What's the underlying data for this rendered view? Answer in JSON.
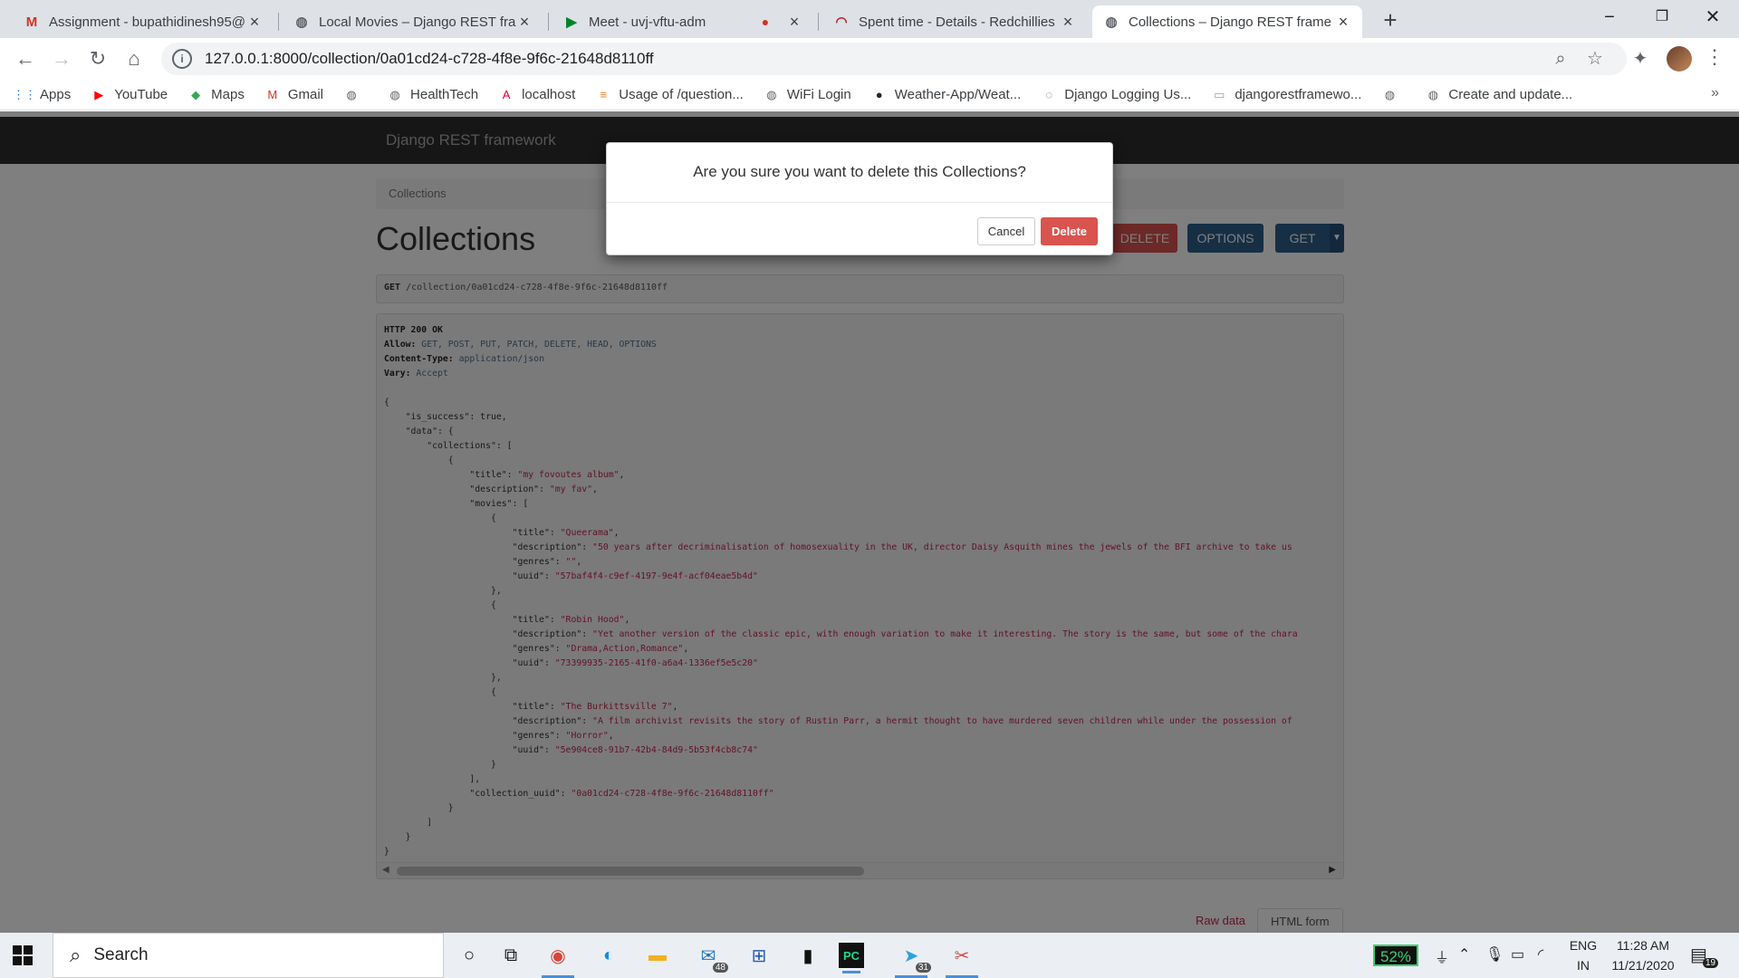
{
  "browser": {
    "tabs": [
      {
        "title": "Assignment - bupathidinesh95@",
        "icon": "gmail-icon",
        "icon_glyph": "M",
        "icon_color": "#d93025",
        "active": false
      },
      {
        "title": "Local Movies – Django REST fram",
        "icon": "globe-icon",
        "icon_glyph": "◍",
        "icon_color": "#5f6368",
        "active": false
      },
      {
        "title": "Meet - uvj-vftu-adm",
        "icon": "meet-icon",
        "icon_glyph": "▶",
        "icon_color": "#00832d",
        "active": false
      },
      {
        "title": "Spent time - Details - Redchillies",
        "icon": "redmine-icon",
        "icon_glyph": "◠",
        "icon_color": "#b32024",
        "active": false
      },
      {
        "title": "Collections – Django REST frame",
        "icon": "globe-icon",
        "icon_glyph": "◍",
        "icon_color": "#5f6368",
        "active": true
      }
    ],
    "url": "127.0.0.1:8000/collection/0a01cd24-c728-4f8e-9f6c-21648d8110ff",
    "bookmarks": [
      {
        "label": "Apps",
        "icon": "apps-grid-icon",
        "glyph": "⋮⋮",
        "color": "#1a73e8"
      },
      {
        "label": "YouTube",
        "icon": "youtube-icon",
        "glyph": "▶",
        "color": "#ff0000"
      },
      {
        "label": "Maps",
        "icon": "maps-icon",
        "glyph": "◆",
        "color": "#34a853"
      },
      {
        "label": "Gmail",
        "icon": "gmail-icon",
        "glyph": "M",
        "color": "#d93025"
      },
      {
        "label": "",
        "icon": "globe-icon",
        "glyph": "◍",
        "color": "#5f6368"
      },
      {
        "label": "HealthTech",
        "icon": "globe-icon",
        "glyph": "◍",
        "color": "#5f6368"
      },
      {
        "label": "localhost",
        "icon": "angular-icon",
        "glyph": "A",
        "color": "#dd0031"
      },
      {
        "label": "Usage of /question...",
        "icon": "stackoverflow-icon",
        "glyph": "≡",
        "color": "#f48024"
      },
      {
        "label": "WiFi Login",
        "icon": "globe-icon",
        "glyph": "◍",
        "color": "#5f6368"
      },
      {
        "label": "Weather-App/Weat...",
        "icon": "github-icon",
        "glyph": "●",
        "color": "#24292e"
      },
      {
        "label": "Django Logging Us...",
        "icon": "lightbulb-icon",
        "glyph": "◌",
        "color": "#5f6368"
      },
      {
        "label": "djangorestframewo...",
        "icon": "page-icon",
        "glyph": "▭",
        "color": "#9aa0a6"
      },
      {
        "label": "",
        "icon": "globe-icon",
        "glyph": "◍",
        "color": "#5f6368"
      },
      {
        "label": "Create and update...",
        "icon": "globe-icon",
        "glyph": "◍",
        "color": "#5f6368"
      }
    ]
  },
  "drf": {
    "brand": "Django REST framework",
    "breadcrumb": "Collections",
    "title": "Collections",
    "buttons": {
      "delete": "DELETE",
      "options": "OPTIONS",
      "get": "GET"
    },
    "request": {
      "method": "GET",
      "path": "/collection/0a01cd24-c728-4f8e-9f6c-21648d8110ff"
    },
    "response_headers": [
      {
        "key": "HTTP 200 OK",
        "value": ""
      },
      {
        "key": "Allow:",
        "value": "GET, POST, PUT, PATCH, DELETE, HEAD, OPTIONS"
      },
      {
        "key": "Content-Type:",
        "value": "application/json"
      },
      {
        "key": "Vary:",
        "value": "Accept"
      }
    ],
    "response_body": {
      "is_success": "true",
      "collection_title": "\"my fovoutes album\"",
      "collection_description": "\"my fav\"",
      "movies": [
        {
          "title": "\"Queerama\"",
          "description": "\"50 years after decriminalisation of homosexuality in the UK, director Daisy Asquith mines the jewels of the BFI archive to take us",
          "genres": "\"\"",
          "uuid": "\"57baf4f4-c9ef-4197-9e4f-acf04eae5b4d\""
        },
        {
          "title": "\"Robin Hood\"",
          "description": "\"Yet another version of the classic epic, with enough variation to make it interesting. The story is the same, but some of the chara",
          "genres": "\"Drama,Action,Romance\"",
          "uuid": "\"73399935-2165-41f0-a6a4-1336ef5e5c20\""
        },
        {
          "title": "\"The Burkittsville 7\"",
          "description": "\"A film archivist revisits the story of Rustin Parr, a hermit thought to have murdered seven children while under the possession of",
          "genres": "\"Horror\"",
          "uuid": "\"5e904ce8-91b7-42b4-84d9-5b53f4cb8c74\""
        }
      ],
      "collection_uuid": "\"0a01cd24-c728-4f8e-9f6c-21648d8110ff\""
    },
    "bottom_tabs": {
      "raw": "Raw data",
      "html": "HTML form"
    },
    "modal": {
      "message": "Are you sure you want to delete this Collections?",
      "cancel": "Cancel",
      "delete": "Delete"
    }
  },
  "taskbar": {
    "search_label": "Search",
    "battery": "52%",
    "lang_top": "ENG",
    "lang_bottom": "IN",
    "time": "11:28 AM",
    "date": "11/21/2020",
    "mail_badge": "48",
    "telegram_badge": "31",
    "notif_badge": "19",
    "apps": [
      {
        "name": "cortana-icon",
        "glyph": "○",
        "color": "#111"
      },
      {
        "name": "task-view-icon",
        "glyph": "⧉",
        "color": "#111"
      },
      {
        "name": "chrome-icon",
        "glyph": "◉",
        "color": "#db4437",
        "active": true
      },
      {
        "name": "edge-icon",
        "glyph": "◐",
        "color": "#0c8ce9"
      },
      {
        "name": "file-explorer-icon",
        "glyph": "▬",
        "color": "#f2b01e"
      },
      {
        "name": "mail-icon",
        "glyph": "✉",
        "color": "#1e73be"
      },
      {
        "name": "network-app-icon",
        "glyph": "⊞",
        "color": "#2a5aa8"
      },
      {
        "name": "terminal-icon",
        "glyph": "▮",
        "color": "#111"
      },
      {
        "name": "pycharm-icon",
        "glyph": "PC",
        "color": "#111",
        "active": true
      },
      {
        "name": "telegram-icon",
        "glyph": "➤",
        "color": "#2aa3df",
        "active": true
      },
      {
        "name": "snipping-tool-icon",
        "glyph": "✂",
        "color": "#d04a4a",
        "active": true
      }
    ]
  }
}
